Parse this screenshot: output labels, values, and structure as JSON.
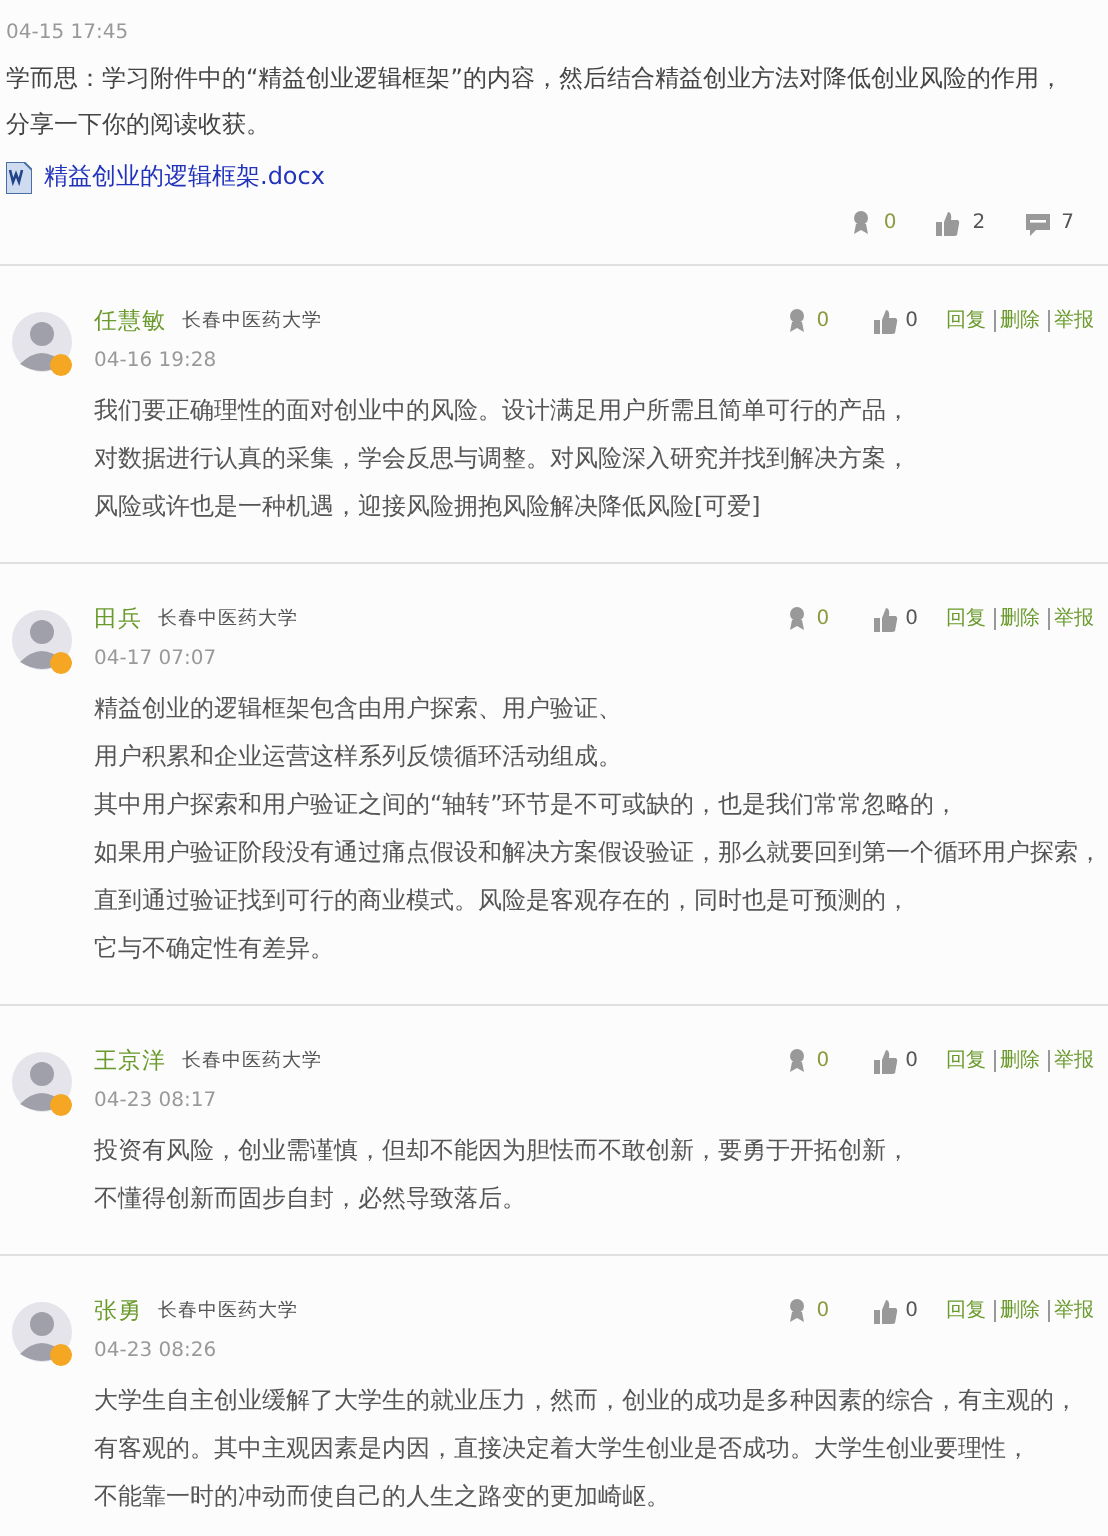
{
  "post": {
    "time": "04-15 17:45",
    "lines": [
      "学而思：学习附件中的“精益创业逻辑框架”的内容，然后结合精益创业方法对降低创业风险的作用，",
      "分享一下你的阅读收获。"
    ],
    "attachment": "精益创业的逻辑框架.docx",
    "awards": "0",
    "likes": "2",
    "comments": "7"
  },
  "comments": [
    {
      "name": "任慧敏",
      "school": "长春中医药大学",
      "time": "04-16 19:28",
      "awards": "0",
      "likes": "0",
      "actions": [
        "回复",
        "删除",
        "举报"
      ],
      "lines": [
        "我们要正确理性的面对创业中的风险。设计满足用户所需且简单可行的产品，",
        "对数据进行认真的采集，学会反思与调整。对风险深入研究并找到解决方案，",
        "风险或许也是一种机遇，迎接风险拥抱风险解决降低风险[可爱]"
      ]
    },
    {
      "name": "田兵",
      "school": "长春中医药大学",
      "time": "04-17 07:07",
      "awards": "0",
      "likes": "0",
      "actions": [
        "回复",
        "删除",
        "举报"
      ],
      "lines": [
        "精益创业的逻辑框架包含由用户探索、用户验证、",
        "用户积累和企业运营这样系列反馈循环活动组成。",
        "其中用户探索和用户验证之间的“轴转”环节是不可或缺的，也是我们常常忽略的，",
        "如果用户验证阶段没有通过痛点假设和解决方案假设验证，那么就要回到第一个循环用户探索，",
        "直到通过验证找到可行的商业模式。风险是客观存在的，同时也是可预测的，",
        "它与不确定性有差异。"
      ]
    },
    {
      "name": "王京洋",
      "school": "长春中医药大学",
      "time": "04-23 08:17",
      "awards": "0",
      "likes": "0",
      "actions": [
        "回复",
        "删除",
        "举报"
      ],
      "lines": [
        "投资有风险，创业需谨慎，但却不能因为胆怯而不敢创新，要勇于开拓创新，",
        "不懂得创新而固步自封，必然导致落后。"
      ]
    },
    {
      "name": "张勇",
      "school": "长春中医药大学",
      "time": "04-23 08:26",
      "awards": "0",
      "likes": "0",
      "actions": [
        "回复",
        "删除",
        "举报"
      ],
      "lines": [
        "大学生自主创业缓解了大学生的就业压力，然而，创业的成功是多种因素的综合，有主观的，",
        "有客观的。其中主观因素是内因，直接决定着大学生创业是否成功。大学生创业要理性，",
        "不能靠一时的冲动而使自己的人生之路变的更加崎岖。"
      ]
    }
  ]
}
